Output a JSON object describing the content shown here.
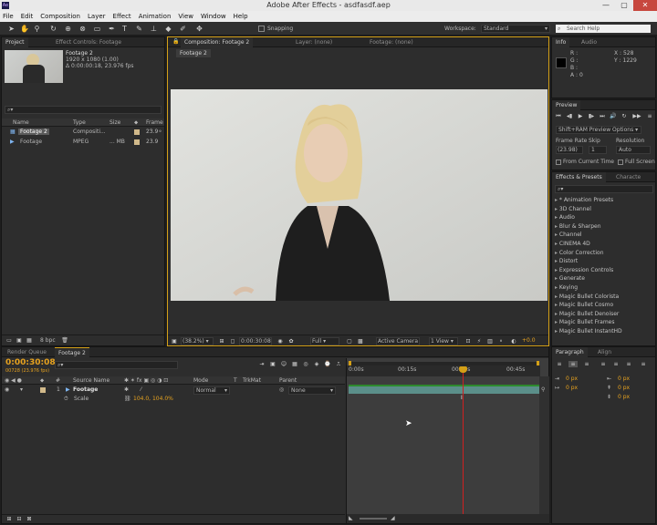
{
  "window": {
    "title": "Adobe After Effects - asdfasdf.aep",
    "app_icon": "Ae",
    "min": "—",
    "max": "▢",
    "close": "✕"
  },
  "menu": [
    "File",
    "Edit",
    "Composition",
    "Layer",
    "Effect",
    "Animation",
    "View",
    "Window",
    "Help"
  ],
  "toolbar": {
    "snapping": "Snapping",
    "workspace_label": "Workspace:",
    "workspace_value": "Standard",
    "search_placeholder": "Search Help"
  },
  "project": {
    "tab": "Project",
    "tab2": "Effect Controls: Footage",
    "item_name": "Footage 2",
    "item_dims": "1920 x 1080 (1.00)",
    "item_dur": "Δ 0:00:00:18, 23.976 fps",
    "search_icon": "⌕▾",
    "columns": {
      "name": "Name",
      "type": "Type",
      "size": "Size",
      "frame": "Frame ..."
    },
    "rows": [
      {
        "name": "Footage 2",
        "type": "Compositi...",
        "size": "",
        "frame": "23.9"
      },
      {
        "name": "Footage",
        "type": "MPEG",
        "size": "... MB",
        "frame": "23.9"
      }
    ],
    "bpc": "8 bpc"
  },
  "comp": {
    "tab": "Composition: Footage 2",
    "tab_layer": "Layer: (none)",
    "tab_footage": "Footage: (none)",
    "breadcrumb": "Footage 2",
    "zoom": "(38.2%)",
    "timecode": "0:00:30:08",
    "resolution": "Full",
    "camera": "Active Camera",
    "view": "1 View",
    "exposure": "+0.0"
  },
  "info": {
    "tab": "Info",
    "tab2": "Audio",
    "r": "R :",
    "g": "G :",
    "b": "B :",
    "a": "A : 0",
    "x": "X : 528",
    "y": "Y : 1229"
  },
  "preview": {
    "tab": "Preview",
    "ram": "Shift+RAM Preview Options",
    "frame_rate_label": "Frame Rate",
    "skip_label": "Skip",
    "resolution_label": "Resolution",
    "frame_rate": "(23.98)",
    "skip": "1",
    "resolution": "Auto",
    "from_current": "From Current Time",
    "full_screen": "Full Screen"
  },
  "effects": {
    "tab": "Effects & Presets",
    "tab2": "Characte",
    "search_icon": "⌕▾",
    "items": [
      "* Animation Presets",
      "3D Channel",
      "Audio",
      "Blur & Sharpen",
      "Channel",
      "CINEMA 4D",
      "Color Correction",
      "Distort",
      "Expression Controls",
      "Generate",
      "Keying",
      "Magic Bullet Colorista",
      "Magic Bullet Cosmo",
      "Magic Bullet Denoiser",
      "Magic Bullet Frames",
      "Magic Bullet InstantHD"
    ]
  },
  "timeline": {
    "tab_render": "Render Queue",
    "tab_comp": "Footage 2",
    "timecode": "0:00:30:08",
    "frames": "00728 (23.976 fps)",
    "search_icon": "⌕▾",
    "cols": {
      "num": "#",
      "source": "Source Name",
      "mode": "Mode",
      "t": "T",
      "trkmat": "TrkMat",
      "parent": "Parent"
    },
    "layer": {
      "num": "1",
      "name": "Footage",
      "mode": "Normal",
      "parent": "None"
    },
    "scale_label": "Scale",
    "scale_value": "104.0, 104.0%",
    "ruler": [
      "0:00s",
      "00:15s",
      "00:30s",
      "00:45s"
    ]
  },
  "paragraph": {
    "tab": "Paragraph",
    "tab2": "Align",
    "px": [
      "0 px",
      "0 px",
      "0 px",
      "0 px",
      "0 px"
    ]
  },
  "colors": {
    "accent": "#e6a21f",
    "playhead": "#d02020",
    "bar": "#5b8f8a"
  }
}
